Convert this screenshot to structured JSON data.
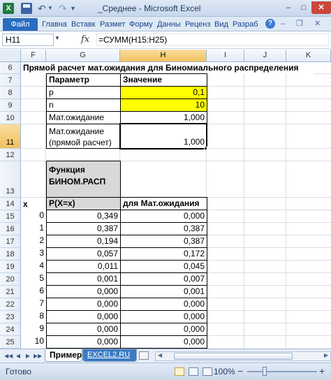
{
  "titlebar": {
    "app_icon_label": "X",
    "title": "_Среднее - Microsoft Excel",
    "minimize": "–",
    "maximize": "□",
    "close": "✕"
  },
  "ribbon": {
    "tabs": [
      {
        "label": "Файл"
      },
      {
        "label": "Главна"
      },
      {
        "label": "Вставк"
      },
      {
        "label": "Размет"
      },
      {
        "label": "Форму"
      },
      {
        "label": "Данны"
      },
      {
        "label": "Реценз"
      },
      {
        "label": "Вид"
      },
      {
        "label": "Разраб"
      }
    ],
    "help": "?"
  },
  "formula_bar": {
    "name_box": "H11",
    "fx": "fx",
    "formula": "=СУММ(H15:H25)"
  },
  "grid": {
    "columns": [
      "F",
      "G",
      "H",
      "I",
      "J",
      "K"
    ],
    "selected_column": "H",
    "selected_row": "11",
    "rows": [
      "6",
      "7",
      "8",
      "9",
      "10",
      "11",
      "12",
      "13",
      "14",
      "15",
      "16",
      "17",
      "18",
      "19",
      "20",
      "21",
      "22",
      "23",
      "24",
      "25"
    ],
    "heading_row6": "Прямой расчет мат.ожидания для Биномиального распределения",
    "params": {
      "header_param": "Параметр",
      "header_value": "Значение",
      "p_label": "p",
      "p_value": "0,1",
      "n_label": "n",
      "n_value": "10",
      "mean_label": "Мат.ожидание",
      "mean_value": "1,000",
      "direct_label_1": "Мат.ожидание",
      "direct_label_2": "(прямой расчет)",
      "direct_value": "1,000"
    },
    "table_header": {
      "func_line1": "Функция",
      "func_line2": "БИНОМ.РАСП",
      "x_label": "x",
      "px_label": "P(X=x)",
      "mean_col_label": "для Мат.ожидания"
    },
    "table_rows": [
      {
        "x": "0",
        "p": "0,349",
        "m": "0,000"
      },
      {
        "x": "1",
        "p": "0,387",
        "m": "0,387"
      },
      {
        "x": "2",
        "p": "0,194",
        "m": "0,387"
      },
      {
        "x": "3",
        "p": "0,057",
        "m": "0,172"
      },
      {
        "x": "4",
        "p": "0,011",
        "m": "0,045"
      },
      {
        "x": "5",
        "p": "0,001",
        "m": "0,007"
      },
      {
        "x": "6",
        "p": "0,000",
        "m": "0,001"
      },
      {
        "x": "7",
        "p": "0,000",
        "m": "0,000"
      },
      {
        "x": "8",
        "p": "0,000",
        "m": "0,000"
      },
      {
        "x": "9",
        "p": "0,000",
        "m": "0,000"
      },
      {
        "x": "10",
        "p": "0,000",
        "m": "0,000"
      }
    ]
  },
  "sheets": {
    "tabs": [
      {
        "label": "Пример"
      },
      {
        "label": "EXCEL2.RU"
      }
    ],
    "nav": [
      "◀◀",
      "◀",
      "▶",
      "▶▶"
    ]
  },
  "status_bar": {
    "status": "Готово",
    "zoom": "100%",
    "zoom_out": "−",
    "zoom_in": "+"
  }
}
